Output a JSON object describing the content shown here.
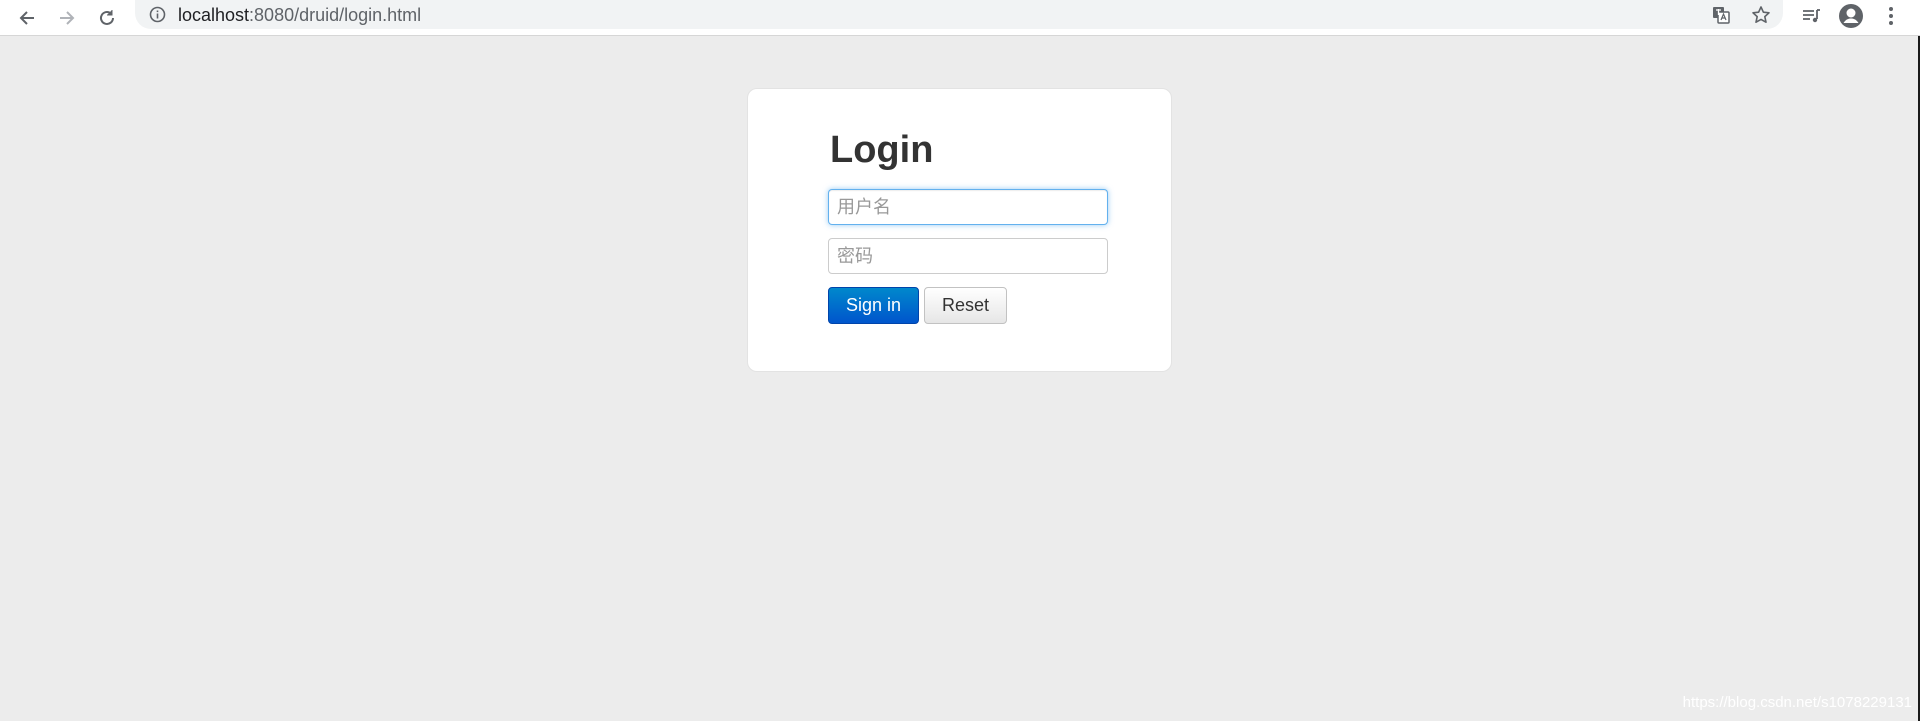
{
  "browser": {
    "url_host": "localhost",
    "url_rest": ":8080/druid/login.html",
    "icons": {
      "back": "back-arrow-icon",
      "forward": "forward-arrow-icon",
      "reload": "reload-icon",
      "site_info": "info-icon",
      "translate": "translate-icon",
      "bookmark": "star-icon",
      "media": "media-playlist-icon",
      "profile": "account-circle-icon",
      "menu": "kebab-menu-icon"
    }
  },
  "login": {
    "title": "Login",
    "username_placeholder": "用户名",
    "password_placeholder": "密码",
    "sign_in_label": "Sign in",
    "reset_label": "Reset"
  },
  "watermark": "https://blog.csdn.net/s1078229131",
  "colors": {
    "page_background": "#ececec",
    "primary_button": "#0066cc",
    "title_text": "#333333"
  }
}
